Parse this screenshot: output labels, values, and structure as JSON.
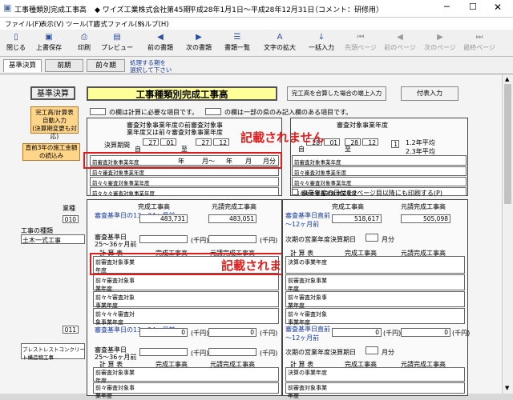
{
  "window": {
    "title": "工事種類別完成工事高",
    "company": "◆ ワイズ工業株式会社",
    "period_no": "第45期",
    "period": "平成28年1月1日～平成28年12月31日",
    "comment": "（コメント：研修用）"
  },
  "menu": [
    "ファイル(F)",
    "表示(V)",
    "ツール(T)",
    "書式ファイル(S)",
    "ヘルプ(H)"
  ],
  "toolbar": [
    "閉じる",
    "上書保存",
    "印刷",
    "プレビュー",
    "前の書類",
    "次の書類",
    "書類一覧",
    "文字の拡大",
    "一括入力",
    "先頭ページ",
    "前のページ",
    "次のページ",
    "最終ページ"
  ],
  "tabs": [
    "基準決算",
    "前期",
    "前々期"
  ],
  "tab_note": [
    "処理する期を",
    "選択して下さい"
  ],
  "form": {
    "kijun": "基準決算",
    "title": "工事種類別完成工事高",
    "btn_calc": [
      "完工高/計算表",
      "自動入力",
      "(決算期変更も対応)"
    ],
    "btn_prev3": [
      "直前3年の施工金額",
      "の読込み"
    ],
    "btn_round": "完工高を合算した場合の端上入力",
    "btn_pay": "付表入力",
    "legend_yellow": "の欄は計算に必要な項目です。",
    "legend_cyan": "の欄は一部の県のみ記入欄のある項目です。",
    "left_head1": "審査対象事業年度の前審査対象事",
    "left_head2": "業年度又は前々審査対象事業年度",
    "right_head1": "審査対象事業年度",
    "kessan": "決算期間",
    "from": "自",
    "to": "至",
    "y1": "27",
    "m1": "01",
    "y2": "27",
    "m2": "12",
    "y3": "28",
    "m3": "01",
    "y4": "28",
    "m4": "12",
    "heikin_val": "1",
    "heikin1": "1.2年平均",
    "heikin2": "2.3年平均",
    "rows_left": [
      "前審査対象事業年度",
      "前々審査対象事業年度",
      "前々々審査対象事業年度",
      "前々々々審査対象事業年度"
    ],
    "rows_right": [
      "前審査対象事業年度",
      "前々審査対象事業年度",
      "前々々審査対象事業年度",
      "前々々々審査対象事業年度"
    ],
    "ym": [
      "年",
      "月～",
      "年",
      "月",
      "月分"
    ],
    "checkbox": "事業年度の日付を2ページ目以降にも印刷する(P)",
    "annot": "記載されません",
    "kind_label": "業種",
    "kind_code1": "010",
    "kind_name1_a": "工事の種類",
    "kind_name1_b": "土木一式工事",
    "kind_code2": "011",
    "kind_name2": "プレストレストコンクリート構造物工事",
    "col_kansei": "完成工事高",
    "col_motouke": "元請完成工事高",
    "s1_left": "審査基準日の13～24ヶ月前",
    "s1_right": "審査基準日直前～12ヶ月前",
    "v1": "483,731",
    "v2": "483,051",
    "v3": "518,617",
    "v4": "505,098",
    "v5": "0",
    "v6": "0",
    "v7": "0",
    "v8": "0",
    "sento": "(千円)",
    "kijun25": "審査基準日",
    "kijun25b": "25～36ヶ月前",
    "kessanki": "次期の営業年度決算期日",
    "getsubun": "月分",
    "keisan": "計 算 表",
    "col2": "完成工事高",
    "col3": "元請完成工事高",
    "calc_rows_left": [
      "前審査対象事業年度",
      "前々審査対象事業年度",
      "前々々審査対象事業年度",
      "前々々々審査対象事業年度"
    ],
    "calc_rows_right": [
      "決算の事業年度",
      "前審査対象事業年度",
      "前々審査対象事業年度",
      "前々々審査対象事業年度"
    ]
  }
}
